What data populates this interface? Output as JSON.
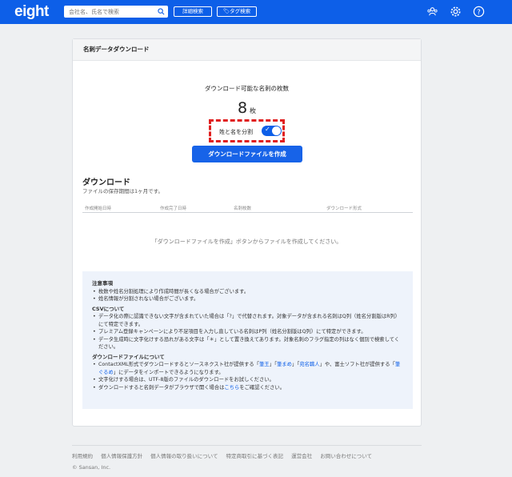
{
  "header": {
    "logo": "eight",
    "search_placeholder": "会社名、氏名で検索",
    "detail_search": "詳細検索",
    "tag_search": "🏷タグ検索"
  },
  "panel": {
    "title": "名刺データダウンロード",
    "count_title": "ダウンロード可能な名刺の枚数",
    "count": "8",
    "count_unit": "枚",
    "split_label": "姓と名を分割",
    "split_enabled": true,
    "create_button": "ダウンロードファイルを作成"
  },
  "download": {
    "title": "ダウンロード",
    "subtitle": "ファイルの保存期間は1ヶ月です。",
    "columns": [
      "作成開始日時",
      "作成完了日時",
      "名刺枚数",
      "ダウンロード形式"
    ],
    "empty_message": "「ダウンロードファイルを作成」ボタンからファイルを作成してください。"
  },
  "notes": {
    "caution_title": "注意事項",
    "caution_items": [
      "枚数や姓名分割処理により作成時間が長くなる場合がございます。",
      "姓名情報が分割されない場合がございます。"
    ],
    "csv_title": "CSVについて",
    "csv_items": [
      "データ化の際に認識できない文字が含まれていた場合は「?」で代替されます。対象データが含まれる名刺はQ列（姓名分割版はR列）にて特定できます。",
      "プレミアム登録キャンペーンにより不足項目を入力し直している名刺はP列（姓名分割版はQ列）にて特定ができます。",
      "データ生成時に文字化けする恐れがある文字は「＊」として置き換えてあります。対象名刺のフラグ指定の列はなく個別で検索してください。"
    ],
    "file_title": "ダウンロードファイルについて",
    "file_item1_pre": "ContactXML形式でダウンロードするとソースネクスト社が提供する「",
    "file_item1_link1": "筆王",
    "file_item1_mid1": "」「",
    "file_item1_link2": "筆まめ",
    "file_item1_mid2": "」「",
    "file_item1_link3": "宛名職人",
    "file_item1_mid3": "」や、富士ソフト社が提供する「",
    "file_item1_link4": "筆ぐるめ",
    "file_item1_post": "」にデータをインポートできるようになります。",
    "file_item2": "文字化けする場合は、UTF-8版のファイルのダウンロードをお試しください。",
    "file_item3_pre": "ダウンロードすると名刺データがブラウザで開く場合は",
    "file_item3_link": "こちら",
    "file_item3_post": "をご確認ください。"
  },
  "footer": {
    "links": [
      "利用規約",
      "個人情報保護方針",
      "個人情報の取り扱いについて",
      "特定商取引に基づく表記",
      "運営会社",
      "お問い合わせについて"
    ],
    "copyright": "© Sansan, Inc."
  },
  "colors": {
    "brand": "#0d5fe8",
    "highlight": "#e02020"
  }
}
